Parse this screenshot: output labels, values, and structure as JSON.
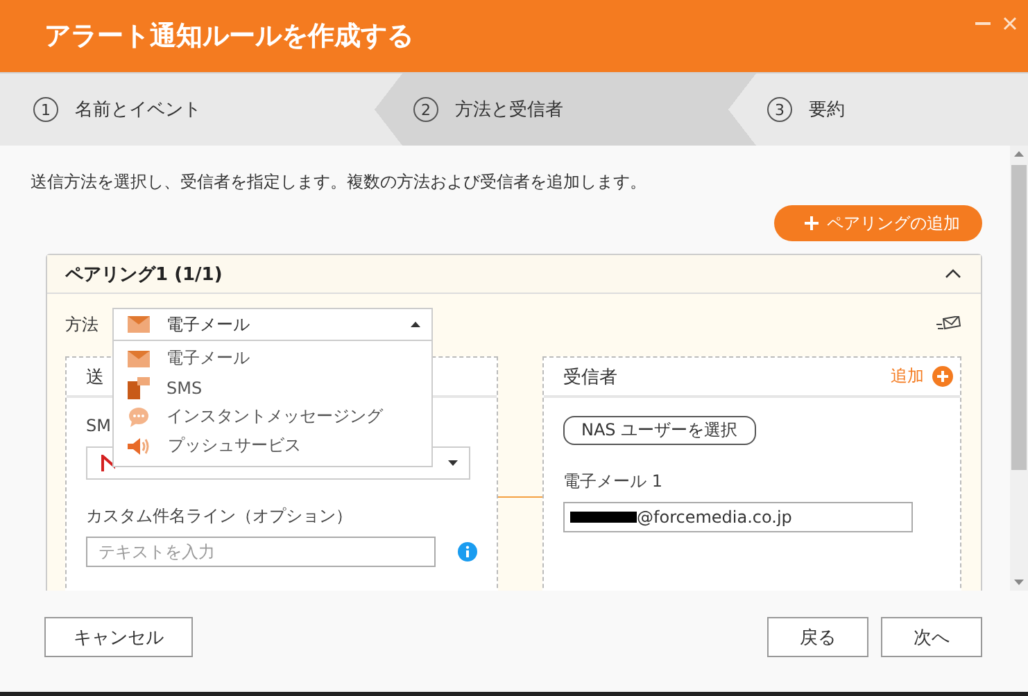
{
  "window": {
    "title": "アラート通知ルールを作成する"
  },
  "steps": [
    {
      "number": "1",
      "label": "名前とイベント",
      "selected": false
    },
    {
      "number": "2",
      "label": "方法と受信者",
      "selected": true
    },
    {
      "number": "3",
      "label": "要約",
      "selected": false
    }
  ],
  "description": "送信方法を選択し、受信者を指定します。複数の方法および受信者を追加します。",
  "add_pairing_button": "ペアリングの追加",
  "pairing": {
    "title": "ペアリング1 (1/1)",
    "expanded": true,
    "method": {
      "label": "方法",
      "value": "電子メール",
      "kind": "email",
      "open": true,
      "options": [
        {
          "label": "電子メール",
          "kind": "email"
        },
        {
          "label": "SMS",
          "kind": "sms"
        },
        {
          "label": "インスタントメッセージング",
          "kind": "im"
        },
        {
          "label": "プッシュサービス",
          "kind": "push"
        }
      ]
    },
    "sender": {
      "title": "送",
      "sms_label": "SM",
      "custom_subject_label": "カスタム件名ライン（オプション）",
      "subject_placeholder": "テキストを入力"
    },
    "recipient": {
      "title": "受信者",
      "add_label": "追加",
      "nas_button": "NAS ユーザーを選択",
      "email_label": "電子メール 1",
      "email_value": "@forcemedia.co.jp",
      "redacted": true
    }
  },
  "footer": {
    "cancel": "キャンセル",
    "back": "戻る",
    "next": "次へ"
  }
}
